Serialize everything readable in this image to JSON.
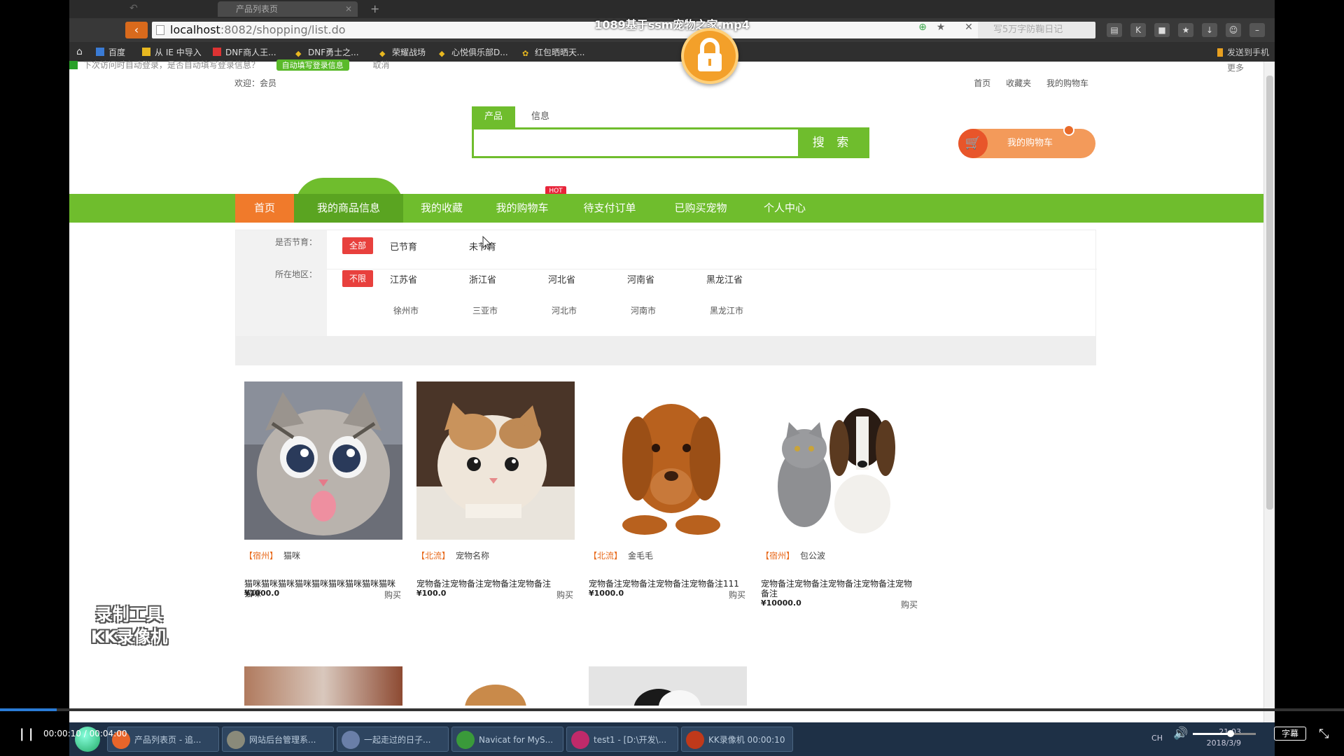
{
  "video": {
    "title": "1089基于ssm宠物之家.mp4",
    "time_current": "00:00:10",
    "time_total": "00:04:00",
    "time_display": "00:00:10 / 00:04:00",
    "progress": 0.042,
    "volume": 0.6,
    "subtitle_label": "字幕",
    "watermark_line1": "录制工具",
    "watermark_line2": "KK录像机"
  },
  "browser": {
    "tab_title": "产品列表页",
    "url_host": "localhost",
    "url_rest": ":8082/shopping/list.do",
    "search_placeholder": "写5万字防鞠日记",
    "favorites": [
      "百度",
      "从 IE 中导入",
      "DNF商人王...",
      "DNF勇士之...",
      "荣耀战场",
      "心悦俱乐部D...",
      "红包晒晒天..."
    ],
    "send_to_phone": "发送到手机"
  },
  "site": {
    "notice": "下次访问时自动登录，是否自动填写登录信息？",
    "notice_pill": "自动填写登录信息",
    "notice_cancel": "取消",
    "more": "更多",
    "welcome": "欢迎：会员",
    "top_links": [
      "首页",
      "收藏夹",
      "我的购物车"
    ],
    "search_tabs": [
      "产品",
      "信息"
    ],
    "search_button": "搜 索",
    "cart_button": "我的购物车",
    "nav": [
      "首页",
      "我的商品信息",
      "我的收藏",
      "我的购物车",
      "待支付订单",
      "已购买宠物",
      "个人中心"
    ],
    "nav_hot": "HOT",
    "filters": {
      "neuter_label": "是否节育：",
      "neuter_all": "全部",
      "neuter_options": [
        "已节育",
        "未节育"
      ],
      "region_label": "所在地区：",
      "region_all": "不限",
      "provinces": [
        "江苏省",
        "浙江省",
        "河北省",
        "河南省",
        "黑龙江省"
      ],
      "cities": [
        "徐州市",
        "三亚市",
        "河北市",
        "河南市",
        "黑龙江市"
      ]
    },
    "products": [
      {
        "region": "【宿州】",
        "name": "猫咪",
        "desc": "猫咪猫咪猫咪猫咪猫咪猫咪猫咪猫咪猫咪猫咪",
        "price": "¥1000.0",
        "buy": "购买"
      },
      {
        "region": "【北流】",
        "name": "宠物名称",
        "desc": "宠物备注宠物备注宠物备注宠物备注",
        "price": "¥100.0",
        "buy": "购买"
      },
      {
        "region": "【北流】",
        "name": "金毛毛",
        "desc": "宠物备注宠物备注宠物备注宠物备注111",
        "price": "¥1000.0",
        "buy": "购买"
      },
      {
        "region": "【宿州】",
        "name": "包公波",
        "desc": "宠物备注宠物备注宠物备注宠物备注宠物备注",
        "price": "¥10000.0",
        "buy": "购买"
      }
    ]
  },
  "taskbar": {
    "items": [
      "产品列表页 - 追...",
      "网站后台管理系...",
      "一起走过的日子...",
      "Navicat for MyS...",
      "test1 - [D:\\开发\\...",
      "KK录像机 00:00:10"
    ],
    "clock_time": "21:03",
    "clock_date": "2018/3/9",
    "tray_lang": "CH"
  },
  "colors": {
    "brand_green": "#6fbd2d",
    "home_orange": "#f07a2b",
    "filter_red": "#e8403d"
  }
}
